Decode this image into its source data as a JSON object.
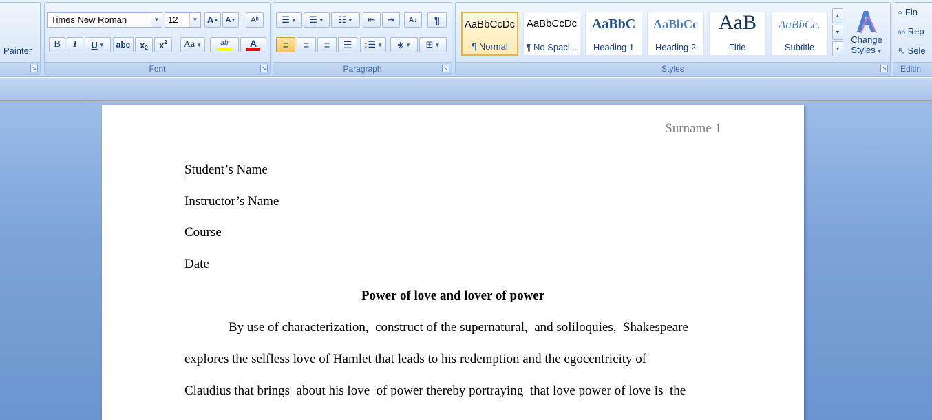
{
  "clipboard": {
    "painter_label": "Painter"
  },
  "font_group": {
    "label": "Font",
    "font_name": "Times New Roman",
    "font_size": "12",
    "grow_label": "A",
    "shrink_label": "A",
    "bold": "B",
    "italic": "I",
    "underline": "U",
    "strike": "abc",
    "subscript": "x",
    "superscript": "x",
    "change_case": "Aa",
    "highlight": "ab",
    "font_color": "A"
  },
  "paragraph_group": {
    "label": "Paragraph",
    "pilcrow": "¶"
  },
  "styles_group": {
    "label": "Styles",
    "items": [
      {
        "sample": "AaBbCcDc",
        "name": "¶ Normal"
      },
      {
        "sample": "AaBbCcDc",
        "name": "¶ No Spaci..."
      },
      {
        "sample": "AaBbC",
        "name": "Heading 1"
      },
      {
        "sample": "AaBbCc",
        "name": "Heading 2"
      },
      {
        "sample": "AaB",
        "name": "Title"
      },
      {
        "sample": "AaBbCc.",
        "name": "Subtitle"
      }
    ],
    "change_styles_label_1": "Change",
    "change_styles_label_2": "Styles"
  },
  "editing_group": {
    "label": "Editin",
    "find": "Fin",
    "replace": "Rep",
    "select": "Sele"
  },
  "document": {
    "header": "Surname 1",
    "lines": [
      "Student’s Name",
      "Instructor’s Name",
      "Course",
      "Date"
    ],
    "title": "Power of love and lover of power",
    "body": [
      "By use of characterization,  construct of the supernatural,  and soliloquies,  Shakespeare",
      "explores the selfless love of Hamlet that leads to his redemption and the egocentricity of",
      "Claudius that brings  about his love  of power thereby portraying  that love power of love is  the"
    ]
  },
  "colors": {
    "ribbon_bg": "#d7e6f9",
    "selected_style": "#ffeab2",
    "highlight_color": "#ffff00",
    "font_color_bar": "#ff0000"
  }
}
